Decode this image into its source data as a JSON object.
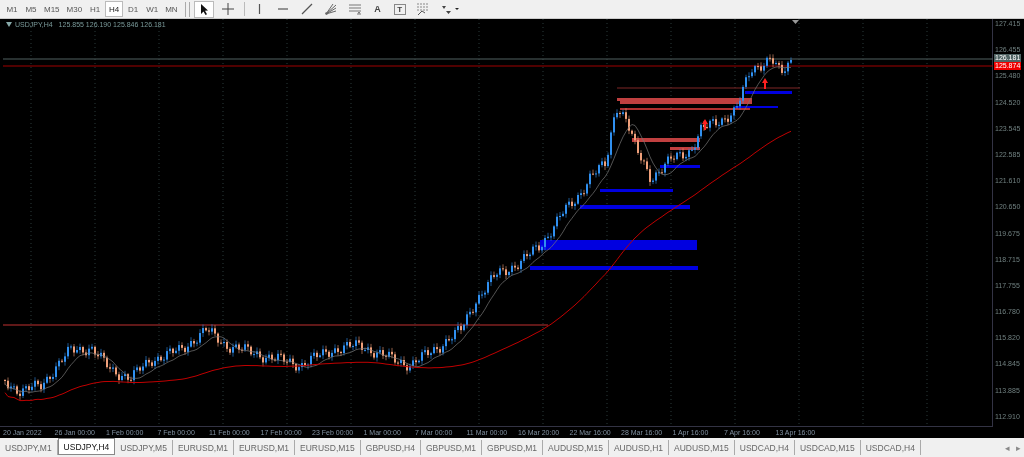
{
  "toolbar": {
    "timeframes": [
      {
        "label": "M1",
        "selected": false
      },
      {
        "label": "M5",
        "selected": false
      },
      {
        "label": "M15",
        "selected": false
      },
      {
        "label": "M30",
        "selected": false
      },
      {
        "label": "H1",
        "selected": false
      },
      {
        "label": "H4",
        "selected": true
      },
      {
        "label": "D1",
        "selected": false
      },
      {
        "label": "W1",
        "selected": false
      },
      {
        "label": "MN",
        "selected": false
      }
    ],
    "tools": [
      {
        "kind": "cursor",
        "selected": true
      },
      {
        "kind": "crosshair",
        "selected": false
      },
      {
        "kind": "vline",
        "selected": false
      },
      {
        "kind": "hline",
        "selected": false
      },
      {
        "kind": "trend",
        "selected": false
      },
      {
        "kind": "fan",
        "selected": false
      },
      {
        "kind": "channel",
        "selected": false
      },
      {
        "kind": "text",
        "label": "A",
        "selected": false
      },
      {
        "kind": "label",
        "label": "T",
        "selected": false
      },
      {
        "kind": "fibo",
        "selected": false
      },
      {
        "kind": "arrows",
        "selected": false
      }
    ]
  },
  "chart": {
    "symbol": "USDJPY,H4",
    "quote": "125.855 126.190 125.846 126.181",
    "price_axis": [
      "127.415",
      "126.455",
      "125.480",
      "124.520",
      "123.545",
      "122.585",
      "121.610",
      "120.650",
      "119.675",
      "118.715",
      "117.755",
      "116.780",
      "115.820",
      "114.845",
      "113.885",
      "112.910"
    ],
    "bid_tag": "126.181",
    "ask_tag": "125.874",
    "time_axis": [
      "20 Jan 2022",
      "26 Jan 00:00",
      "1 Feb 00:00",
      "7 Feb 00:00",
      "11 Feb 00:00",
      "17 Feb 00:00",
      "23 Feb 00:00",
      "1 Mar 00:00",
      "7 Mar 00:00",
      "11 Mar 00:00",
      "16 Mar 20:00",
      "22 Mar 16:00",
      "28 Mar 16:00",
      "1 Apr 16:00",
      "7 Apr 16:00",
      "13 Apr 16:00"
    ]
  },
  "tabs": [
    {
      "label": "USDJPY,M1",
      "selected": false
    },
    {
      "label": "USDJPY,H4",
      "selected": true
    },
    {
      "label": "USDJPY,M5",
      "selected": false
    },
    {
      "label": "EURUSD,M1",
      "selected": false
    },
    {
      "label": "EURUSD,M1",
      "selected": false
    },
    {
      "label": "EURUSD,M15",
      "selected": false
    },
    {
      "label": "GBPUSD,H4",
      "selected": false
    },
    {
      "label": "GBPUSD,M1",
      "selected": false
    },
    {
      "label": "GBPUSD,M1",
      "selected": false
    },
    {
      "label": "AUDUSD,M15",
      "selected": false
    },
    {
      "label": "AUDUSD,H1",
      "selected": false
    },
    {
      "label": "AUDUSD,M15",
      "selected": false
    },
    {
      "label": "USDCAD,H4",
      "selected": false
    },
    {
      "label": "USDCAD,M15",
      "selected": false
    },
    {
      "label": "USDCAD,H4",
      "selected": false
    }
  ],
  "tab_scroll": [
    "◂",
    "▸"
  ]
}
